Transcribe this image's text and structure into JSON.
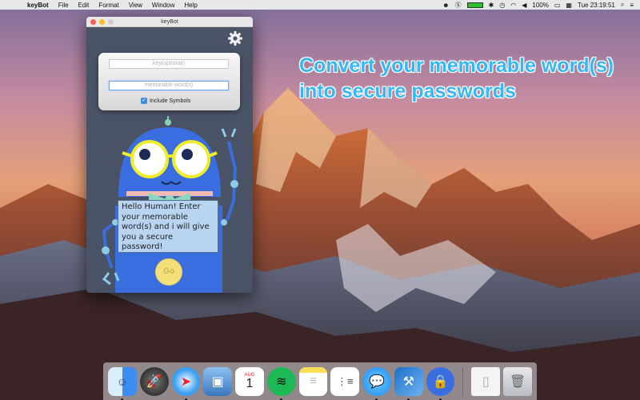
{
  "menubar": {
    "app_name": "keyBot",
    "menus": [
      "File",
      "Edit",
      "Format",
      "View",
      "Window",
      "Help"
    ],
    "battery": "100%",
    "clock": "Tue 23:19:51"
  },
  "headline": {
    "line1": "Convert your memorable word(s)",
    "line2": "into secure passwords"
  },
  "window": {
    "title": "keyBot",
    "key_placeholder": "key(optional)",
    "word_placeholder": "memorable word(s)",
    "include_symbols_label": "Include Symbols",
    "include_symbols_checked": true,
    "speech": "Hello Human! Enter your memorable word(s) and i will give you a secure password!",
    "go_label": "Go"
  },
  "dock": {
    "icons": [
      "finder-icon",
      "launchpad-icon",
      "safari-icon",
      "preview-icon",
      "calendar-icon",
      "spotify-icon",
      "notes-icon",
      "reminders-icon",
      "messages-icon",
      "xcode-icon",
      "keybot-icon",
      "document-icon",
      "trash-icon"
    ],
    "calendar_month": "AUG",
    "calendar_day": "1"
  },
  "colors": {
    "headline": "#37b8f4",
    "window_bg": "#4a5266",
    "robot_body": "#3a6ee0",
    "go_button": "#f4e07a"
  }
}
